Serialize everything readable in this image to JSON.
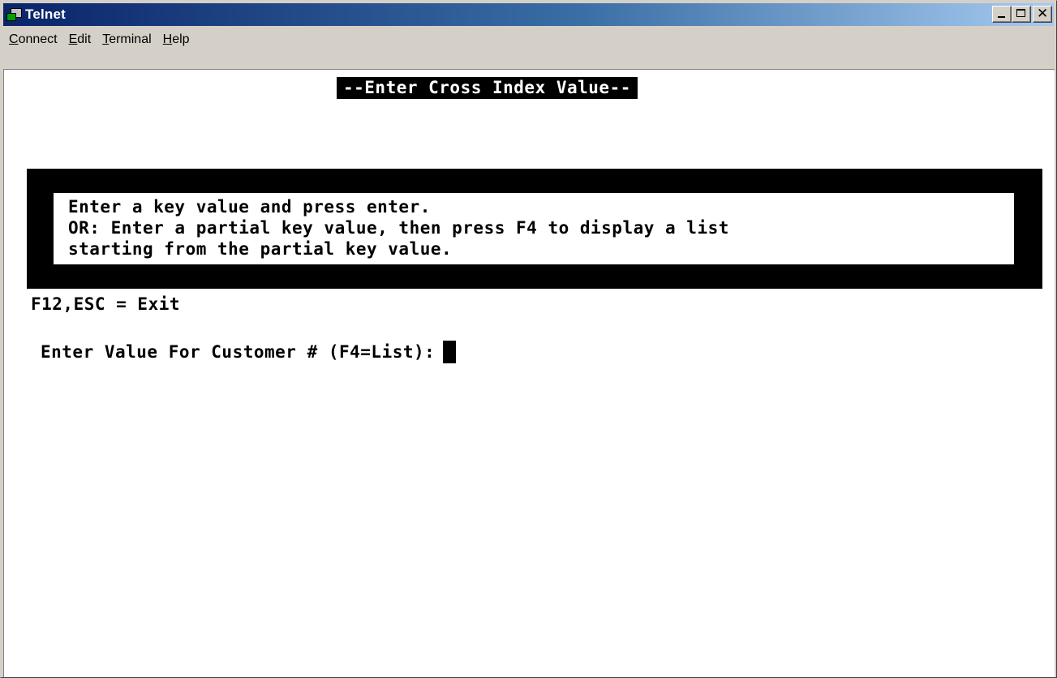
{
  "window": {
    "title": "Telnet",
    "icon": "telnet-app-icon"
  },
  "menubar": {
    "items": [
      {
        "label": "Connect",
        "mnemonic": "C"
      },
      {
        "label": "Edit",
        "mnemonic": "E"
      },
      {
        "label": "Terminal",
        "mnemonic": "T"
      },
      {
        "label": "Help",
        "mnemonic": "H"
      }
    ]
  },
  "terminal": {
    "screen_title": "--Enter Cross Index Value--",
    "instructions": [
      "Enter a key value and press enter.",
      "OR: Enter a partial key value, then press F4 to display a list",
      "starting from the partial key value."
    ],
    "exit_hint": "F12,ESC = Exit",
    "prompt_label": "Enter Value For Customer # (F4=List):",
    "input_value": ""
  },
  "colors": {
    "titlebar_start": "#0a246a",
    "titlebar_end": "#a6caf0",
    "terminal_bg": "#ffffff",
    "terminal_fg": "#000000"
  }
}
